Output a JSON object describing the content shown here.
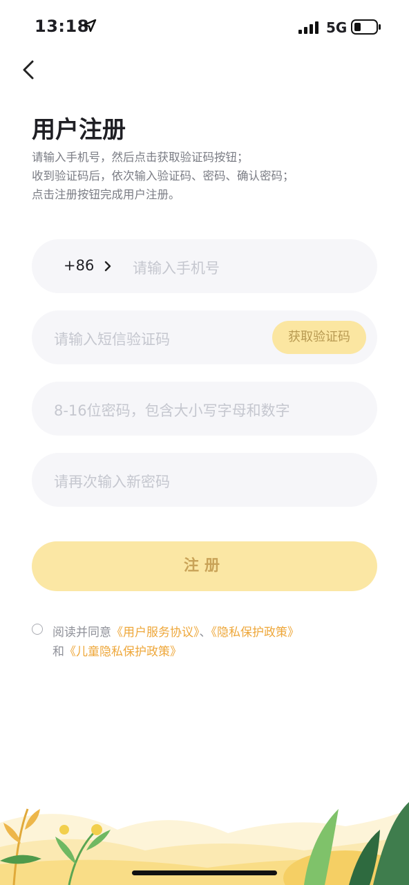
{
  "status": {
    "time": "13:18",
    "network": "5G"
  },
  "page": {
    "title": "用户注册",
    "description": [
      "请输入手机号，然后点击获取验证码按钮；",
      "收到验证码后，依次输入验证码、密码、确认密码；",
      "点击注册按钮完成用户注册。"
    ]
  },
  "form": {
    "country_code": "+86",
    "phone_placeholder": "请输入手机号",
    "sms_placeholder": "请输入短信验证码",
    "get_code_label": "获取验证码",
    "password_placeholder": "8-16位密码，包含大小写字母和数字",
    "confirm_placeholder": "请再次输入新密码",
    "register_label": "注册"
  },
  "agreement": {
    "prefix": "阅读并同意",
    "terms_link": "《用户服务协议》",
    "separator": "、",
    "privacy_link": "《隐私保护政策》",
    "and": "和",
    "children_link": "《儿童隐私保护政策》"
  },
  "colors": {
    "accent": "#fbe7a4",
    "link": "#eea73a",
    "field_bg": "#f6f6f9"
  }
}
